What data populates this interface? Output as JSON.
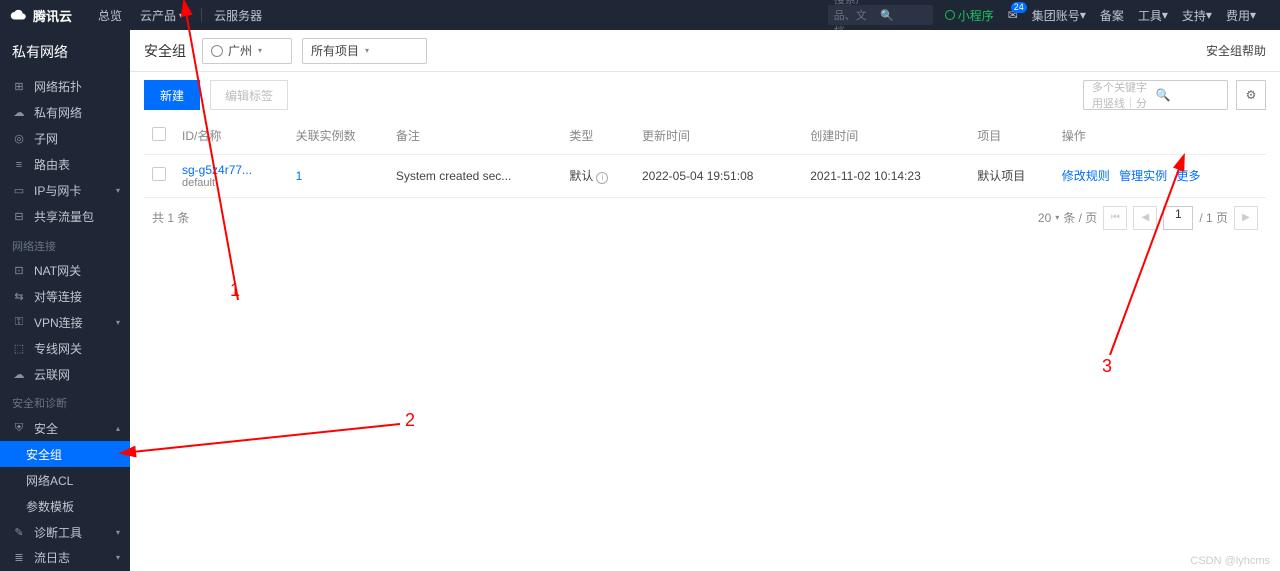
{
  "header": {
    "brand": "腾讯云",
    "nav_overview": "总览",
    "nav_products": "云产品",
    "nav_cvm": "云服务器",
    "search_placeholder": "搜索产品、文档…",
    "mini_program": "小程序",
    "mail_badge": "24",
    "group_account": "集团账号",
    "beian": "备案",
    "tools": "工具",
    "support": "支持",
    "cost": "费用"
  },
  "sidebar": {
    "title": "私有网络",
    "items": [
      {
        "icon": "topology",
        "label": "网络拓扑"
      },
      {
        "icon": "vpc",
        "label": "私有网络"
      },
      {
        "icon": "subnet",
        "label": "子网"
      },
      {
        "icon": "route",
        "label": "路由表"
      },
      {
        "icon": "nic",
        "label": "IP与网卡",
        "sub": true
      },
      {
        "icon": "bandwidth",
        "label": "共享流量包"
      }
    ],
    "group_conn": "网络连接",
    "conn_items": [
      {
        "icon": "nat",
        "label": "NAT网关"
      },
      {
        "icon": "peer",
        "label": "对等连接"
      },
      {
        "icon": "vpn",
        "label": "VPN连接",
        "sub": true
      },
      {
        "icon": "direct",
        "label": "专线网关"
      },
      {
        "icon": "ccn",
        "label": "云联网"
      }
    ],
    "group_sec": "安全和诊断",
    "sec_parent": "安全",
    "sec_items": [
      {
        "label": "安全组",
        "active": true
      },
      {
        "label": "网络ACL"
      },
      {
        "label": "参数模板"
      }
    ],
    "diag": "诊断工具",
    "flowlog": "流日志"
  },
  "page": {
    "title": "安全组",
    "region": "广州",
    "project_filter": "所有项目",
    "help": "安全组帮助"
  },
  "toolbar": {
    "new_btn": "新建",
    "tag_btn": "编辑标签",
    "search_placeholder": "多个关键字用竖线｜分"
  },
  "table": {
    "cols": {
      "id_name": "ID/名称",
      "assoc": "关联实例数",
      "remark": "备注",
      "type": "类型",
      "update_time": "更新时间",
      "create_time": "创建时间",
      "project": "项目",
      "ops": "操作"
    },
    "row": {
      "id": "sg-g5z4r77...",
      "name": "default",
      "assoc": "1",
      "remark": "System created sec...",
      "type": "默认",
      "update_time": "2022-05-04 19:51:08",
      "create_time": "2021-11-02 10:14:23",
      "project": "默认项目",
      "op_edit_rule": "修改规则",
      "op_manage": "管理实例",
      "op_more": "更多"
    }
  },
  "pager": {
    "total_text": "共 1 条",
    "page_size": "20",
    "per_page": "条 / 页",
    "current": "1",
    "total_pages": "/ 1 页"
  },
  "annotations": {
    "a1": "1",
    "a2": "2",
    "a3": "3"
  },
  "watermark": "CSDN @lyhcms"
}
